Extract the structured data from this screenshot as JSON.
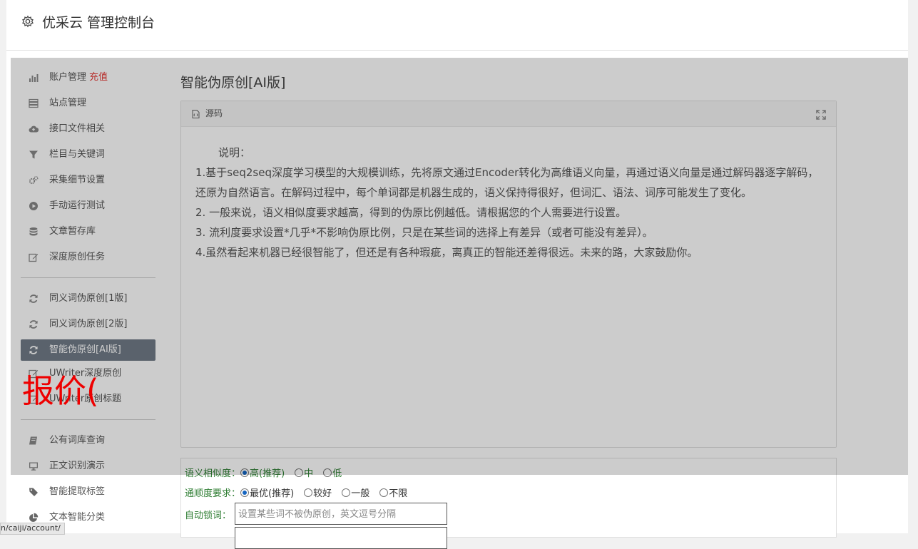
{
  "header": {
    "title": "优采云 管理控制台"
  },
  "sidebar": {
    "groups": [
      [
        {
          "label": "账户管理",
          "badge": "充值",
          "icon": "bar-chart-icon"
        },
        {
          "label": "站点管理",
          "icon": "server-icon"
        },
        {
          "label": "接口文件相关",
          "icon": "cloud-upload-icon"
        },
        {
          "label": "栏目与关键词",
          "icon": "filter-icon"
        },
        {
          "label": "采集细节设置",
          "icon": "gears-icon"
        },
        {
          "label": "手动运行测试",
          "icon": "play-circle-icon"
        },
        {
          "label": "文章暂存库",
          "icon": "database-icon"
        },
        {
          "label": "深度原创任务",
          "icon": "edit-icon"
        }
      ],
      [
        {
          "label": "同义词伪原创[1版]",
          "icon": "refresh-icon"
        },
        {
          "label": "同义词伪原创[2版]",
          "icon": "refresh-icon"
        },
        {
          "label": "智能伪原创[AI版]",
          "icon": "refresh-icon",
          "active": true
        },
        {
          "label": "UWriter深度原创",
          "icon": "edit-icon"
        },
        {
          "label": "UWriter原创标题",
          "icon": "edit-icon"
        }
      ],
      [
        {
          "label": "公有词库查询",
          "icon": "book-icon"
        },
        {
          "label": "正文识别演示",
          "icon": "monitor-icon"
        },
        {
          "label": "智能提取标签",
          "icon": "tag-icon"
        },
        {
          "label": "文本智能分类",
          "icon": "pie-chart-icon"
        }
      ]
    ]
  },
  "main": {
    "title": "智能伪原创[AI版]",
    "panel": {
      "header": "源码",
      "note_title": "说明：",
      "lines": [
        "1.基于seq2seq深度学习模型的大规模训练，先将原文通过Encoder转化为高维语义向量，再通过语义向量是通过解码器逐字解码，还原为自然语言。在解码过程中，每个单词都是机器生成的，语义保持得很好，但词汇、语法、词序可能发生了变化。",
        "2. 一般来说，语义相似度要求越高，得到的伪原比例越低。请根据您的个人需要进行设置。",
        "3. 流利度要求设置*几乎*不影响伪原比例，只是在某些词的选择上有差异（或者可能没有差异）。",
        "4.虽然看起来机器已经很智能了，但还是有各种瑕疵，离真正的智能还差得很远。未来的路，大家鼓励你。"
      ]
    },
    "form": {
      "similarity": {
        "label": "语义相似度：",
        "options": [
          "高(推荐)",
          "中",
          "低"
        ],
        "selected": 0
      },
      "fluency": {
        "label": "通顺度要求：",
        "options": [
          "最优(推荐)",
          "较好",
          "一般",
          "不限"
        ],
        "selected": 0
      },
      "lock": {
        "label": "自动锁词：",
        "placeholder": "设置某些词不被伪原创，英文逗号分隔"
      }
    }
  },
  "overlay_text": "报价(",
  "status_url": "n/caiji/account/"
}
